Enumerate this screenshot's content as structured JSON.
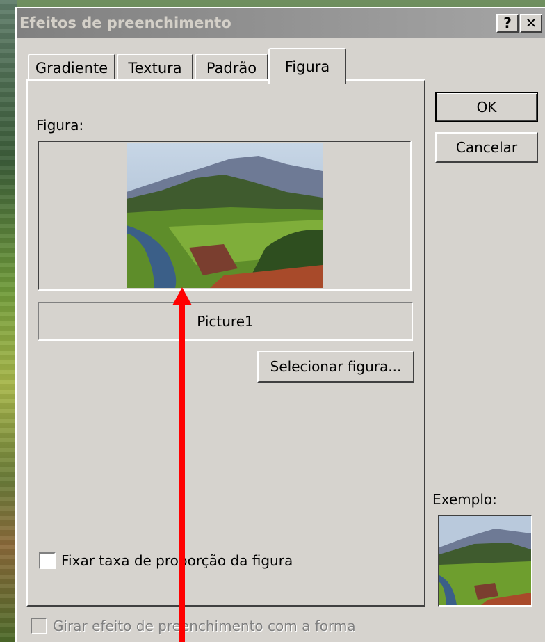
{
  "window": {
    "title": "Efeitos de preenchimento",
    "help_label": "?",
    "close_label": "✕"
  },
  "tabs": [
    {
      "label": "Gradiente",
      "active": false
    },
    {
      "label": "Textura",
      "active": false
    },
    {
      "label": "Padrão",
      "active": false
    },
    {
      "label": "Figura",
      "active": true
    }
  ],
  "panel": {
    "picture_label": "Figura:",
    "picture_name": "Picture1",
    "select_button": "Selecionar figura...",
    "lock_aspect_label": "Fixar taxa de proporção da figura",
    "lock_aspect_checked": false
  },
  "buttons": {
    "ok": "OK",
    "cancel": "Cancelar"
  },
  "example_label": "Exemplo:",
  "rotate_label": "Girar efeito de preenchimento com a forma",
  "rotate_checked": false,
  "colors": {
    "accent_arrow": "#ff0000",
    "dialog_bg": "#d6d3ce",
    "titlebar": "#808080"
  }
}
